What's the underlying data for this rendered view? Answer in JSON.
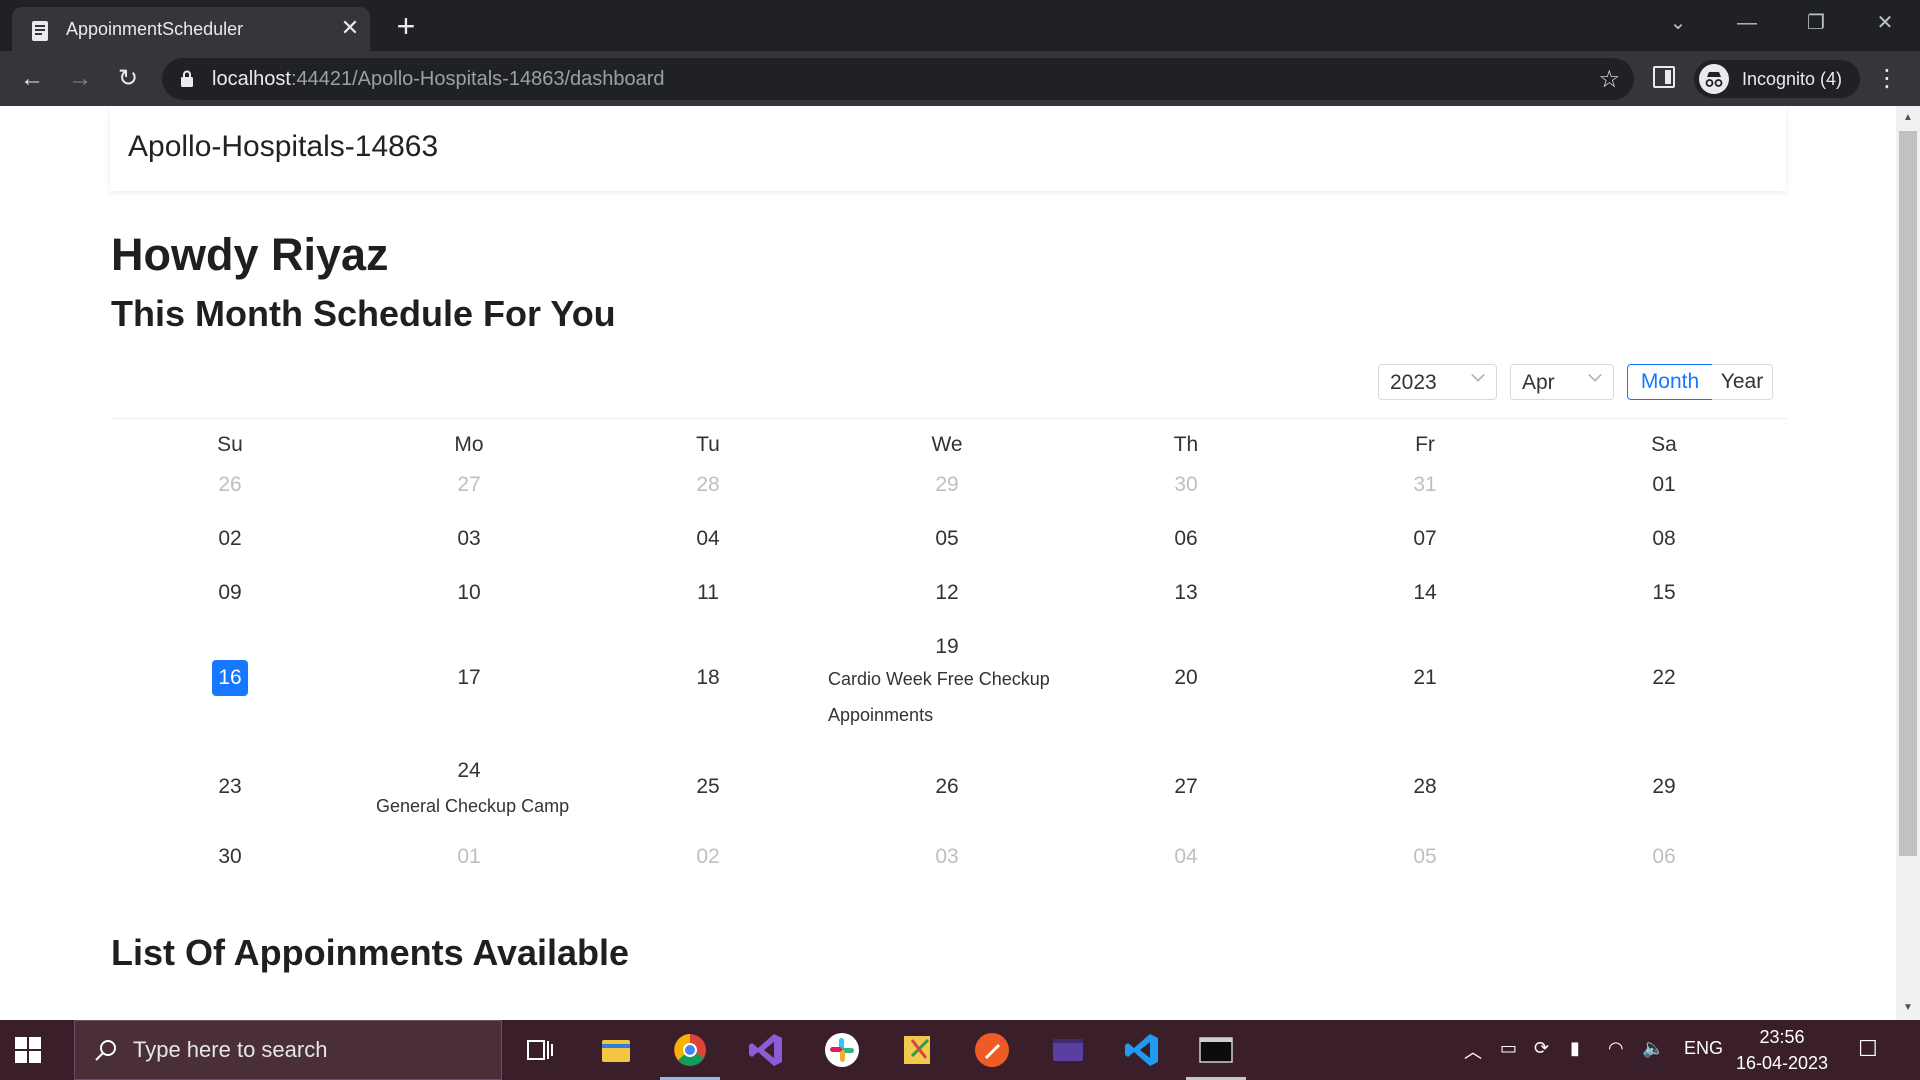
{
  "browser": {
    "tab_title": "AppoinmentScheduler",
    "url_host": "localhost",
    "url_path": ":44421/Apollo-Hospitals-14863/dashboard",
    "profile_label": "Incognito (4)"
  },
  "navbar": {
    "brand": "Apollo-Hospitals-14863"
  },
  "header": {
    "greeting": "Howdy Riyaz",
    "subtitle": "This Month Schedule For You"
  },
  "calendar": {
    "year": "2023",
    "month": "Apr",
    "modes": [
      "Month",
      "Year"
    ],
    "active_mode": "Month",
    "weekdays": [
      "Su",
      "Mo",
      "Tu",
      "We",
      "Th",
      "Fr",
      "Sa"
    ],
    "weeks": [
      [
        "26",
        "27",
        "28",
        "29",
        "30",
        "31",
        "01"
      ],
      [
        "02",
        "03",
        "04",
        "05",
        "06",
        "07",
        "08"
      ],
      [
        "09",
        "10",
        "11",
        "12",
        "13",
        "14",
        "15"
      ],
      [
        "16",
        "17",
        "18",
        "19",
        "20",
        "21",
        "22"
      ],
      [
        "23",
        "24",
        "25",
        "26",
        "27",
        "28",
        "29"
      ],
      [
        "30",
        "01",
        "02",
        "03",
        "04",
        "05",
        "06"
      ]
    ],
    "today": "16",
    "events": {
      "apr19": [
        "Cardio Week Free Checkup",
        "Appoinments"
      ],
      "apr24": [
        "General Checkup Camp"
      ]
    }
  },
  "list": {
    "title": "List Of Appoinments Available"
  },
  "taskbar": {
    "search_placeholder": "Type here to search",
    "language": "ENG",
    "time": "23:56",
    "date": "16-04-2023"
  }
}
